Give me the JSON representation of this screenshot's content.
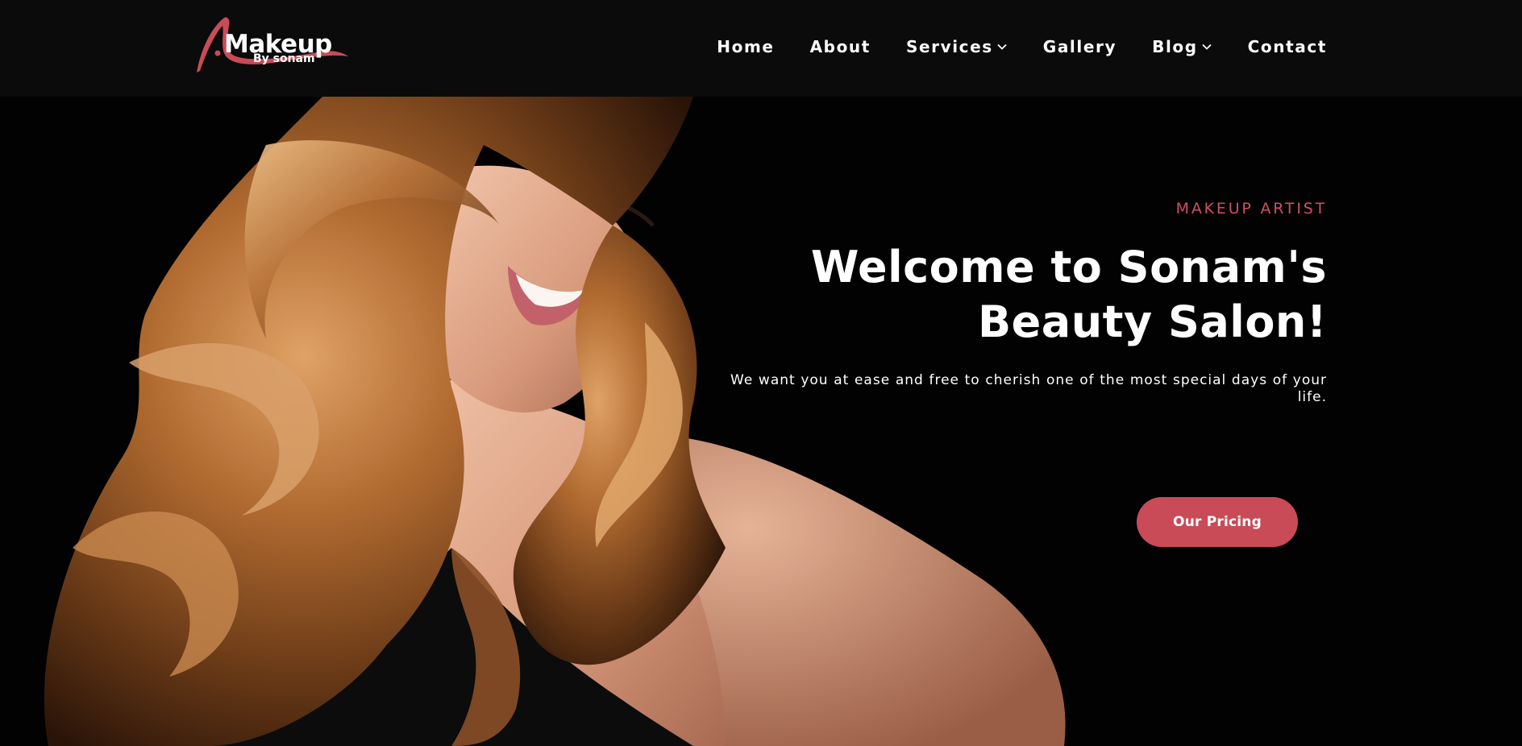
{
  "brand": {
    "logo_main": "Makeup",
    "logo_sub": "By sonam",
    "accent_color": "#c94b58"
  },
  "nav": {
    "items": [
      {
        "label": "Home",
        "has_dropdown": false
      },
      {
        "label": "About",
        "has_dropdown": false
      },
      {
        "label": "Services",
        "has_dropdown": true
      },
      {
        "label": "Gallery",
        "has_dropdown": false
      },
      {
        "label": "Blog",
        "has_dropdown": true
      },
      {
        "label": "Contact",
        "has_dropdown": false
      }
    ]
  },
  "hero": {
    "eyebrow": "MAKEUP ARTIST",
    "title_line1": "Welcome to Sonam's",
    "title_line2": "Beauty Salon!",
    "subtitle": "We want you at ease and free to cherish one of the most special days of your life.",
    "cta_label": "Our Pricing"
  }
}
